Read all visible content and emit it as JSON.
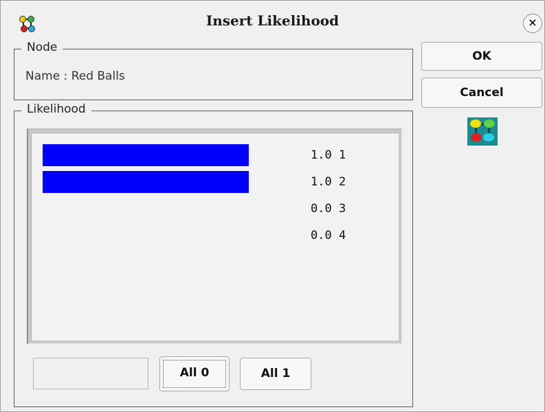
{
  "window": {
    "title": "Insert Likelihood",
    "close_glyph": "×",
    "app_icon": "network-nodes-icon"
  },
  "node_group": {
    "legend": "Node",
    "name_text": "Name : Red Balls"
  },
  "likelihood_group": {
    "legend": "Likelihood",
    "items": [
      {
        "label": "1.0 1",
        "value": 1.0
      },
      {
        "label": "1.0 2",
        "value": 1.0
      },
      {
        "label": "0.0 3",
        "value": 0.0
      },
      {
        "label": "0.0 4",
        "value": 0.0
      }
    ],
    "bar_color": "#0000ff",
    "value_input": "",
    "all0_label": "All 0",
    "all1_label": "All 1"
  },
  "buttons": {
    "ok_label": "OK",
    "cancel_label": "Cancel",
    "side_icon": "network-nodes-icon"
  }
}
